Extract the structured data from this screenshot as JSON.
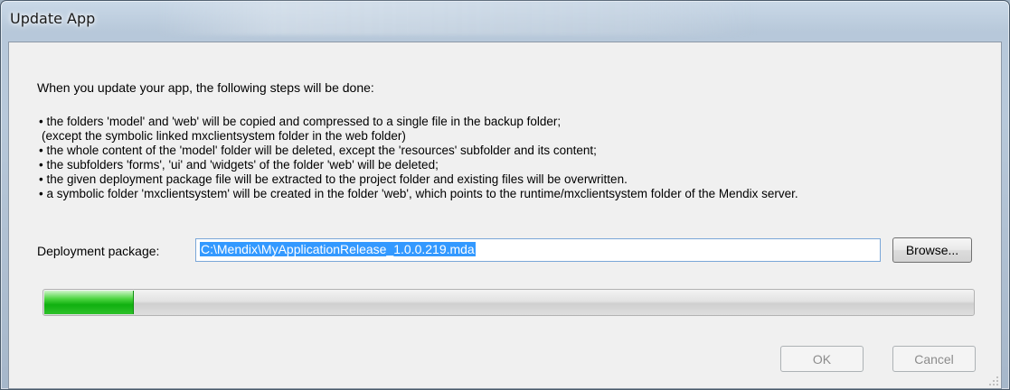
{
  "window": {
    "title": "Update App"
  },
  "dialog": {
    "intro": "When you update your app, the following steps will be done:",
    "steps": [
      "• the folders 'model' and 'web' will be copied and compressed to a single file in the backup folder;",
      "  (except the symbolic linked mxclientsystem folder in the web folder)",
      "• the whole content of the 'model' folder will be deleted, except the 'resources' subfolder and its content;",
      "• the subfolders 'forms', 'ui' and 'widgets' of the folder 'web' will be deleted;",
      "• the given deployment package file will be extracted to the project folder and existing files will be overwritten.",
      "• a symbolic folder 'mxclientsystem' will be created in the folder 'web', which points to the runtime/mxclientsystem folder of the Mendix server."
    ],
    "deployment_label": "Deployment package:",
    "deployment_value": "C:\\Mendix\\MyApplicationRelease_1.0.0.219.mda",
    "browse_label": "Browse...",
    "progress_fraction": 0.095,
    "ok_label": "OK",
    "cancel_label": "Cancel"
  },
  "colors": {
    "progress_green": "#10b010",
    "selection_blue": "#3399ff"
  }
}
